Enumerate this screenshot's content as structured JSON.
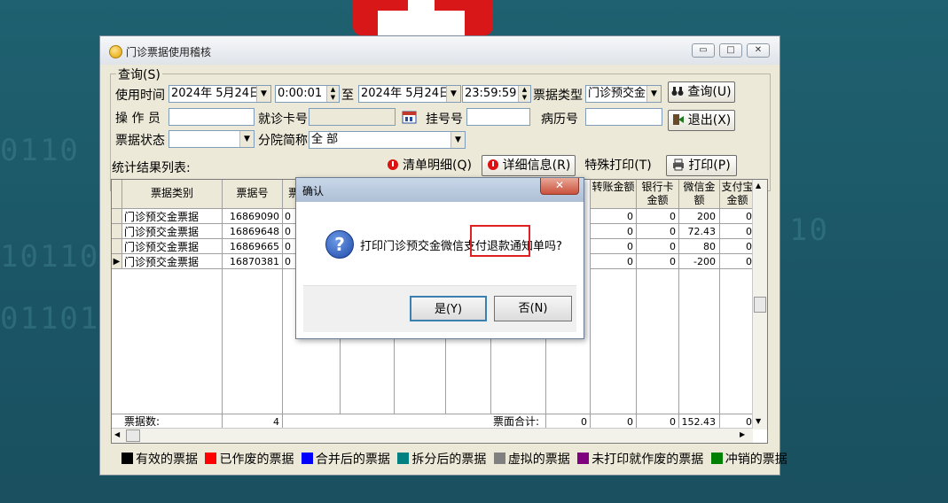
{
  "window": {
    "title": "门诊票据使用稽核",
    "min_glyph": "▭",
    "max_glyph": "□",
    "close_glyph": "✕"
  },
  "query": {
    "group_label": "查询(S)",
    "use_time_label": "使用时间",
    "date_from": "2024年  5月24日",
    "time_from": "0:00:01",
    "to_label": "至",
    "date_to": "2024年  5月24日",
    "time_to": "23:59:59",
    "ticket_type_label": "票据类型",
    "ticket_type_value": "门诊预交金",
    "query_button": "查询(U)",
    "operator_label": "操 作 员",
    "operator_value": "",
    "card_no_label": "就诊卡号",
    "card_no_value": "",
    "reg_no_label": "挂号号",
    "reg_no_value": "",
    "record_no_label": "病历号",
    "record_no_value": "",
    "exit_button": "退出(X)",
    "status_label": "票据状态",
    "status_value": "",
    "branch_label": "分院简称",
    "branch_value": "全 部"
  },
  "results": {
    "label": "统计结果列表:",
    "btn_detail_list": "清单明细(Q)",
    "btn_detail_info": "详细信息(R)",
    "btn_special_print": "特殊打印(T)",
    "btn_print": "打印(P)"
  },
  "table": {
    "headers_left": [
      "票据类别",
      "票据号",
      "票据"
    ],
    "headers_right": [
      "转账金额",
      "银行卡金额",
      "微信金额",
      "支付宝金额"
    ],
    "rows": [
      {
        "type": "门诊预交金票据",
        "no": "16869090",
        "c3": "0",
        "transfer": "0",
        "bank": "0",
        "wechat": "200",
        "alipay": "0"
      },
      {
        "type": "门诊预交金票据",
        "no": "16869648",
        "c3": "0",
        "transfer": "0",
        "bank": "0",
        "wechat": "72.43",
        "alipay": "0"
      },
      {
        "type": "门诊预交金票据",
        "no": "16869665",
        "c3": "0",
        "transfer": "0",
        "bank": "0",
        "wechat": "80",
        "alipay": "0"
      },
      {
        "type": "门诊预交金票据",
        "no": "16870381",
        "c3": "0",
        "transfer": "0",
        "bank": "0",
        "wechat": "-200",
        "alipay": "0"
      }
    ],
    "footer_count_label": "票据数:",
    "footer_count": "4",
    "footer_total_label": "票面合计:",
    "footer_t1": "0",
    "footer_t2": "0",
    "footer_t3": "0",
    "footer_t4": "152.43",
    "footer_t5": "0"
  },
  "legend": [
    {
      "color": "#000000",
      "label": "有效的票据"
    },
    {
      "color": "#ff0000",
      "label": "已作废的票据"
    },
    {
      "color": "#0000ff",
      "label": "合并后的票据"
    },
    {
      "color": "#008080",
      "label": "拆分后的票据"
    },
    {
      "color": "#808080",
      "label": "虚拟的票据"
    },
    {
      "color": "#800080",
      "label": "未打印就作废的票据"
    },
    {
      "color": "#008000",
      "label": "冲销的票据"
    }
  ],
  "dialog": {
    "title": "确认",
    "message": "打印门诊预交金微信支付退款通知单吗?",
    "yes": "是(Y)",
    "no": "否(N)",
    "close_glyph": "✕"
  }
}
